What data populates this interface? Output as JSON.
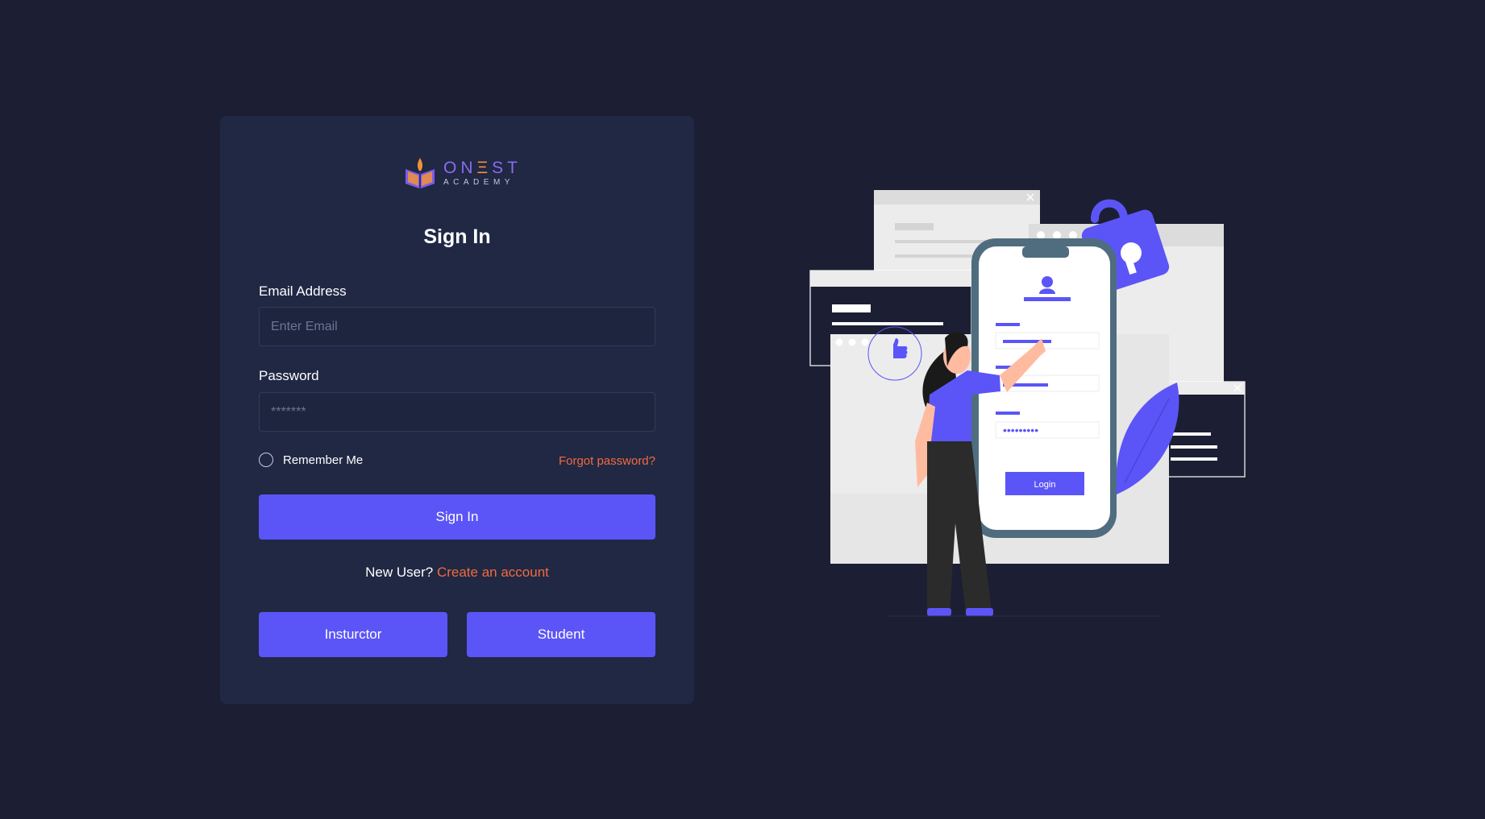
{
  "logo": {
    "main_o": "ON",
    "main_e": "Ξ",
    "main_rest": "ST",
    "sub": "ACADEMY"
  },
  "form": {
    "title": "Sign In",
    "email_label": "Email Address",
    "email_placeholder": "Enter Email",
    "password_label": "Password",
    "password_placeholder": "*******",
    "remember_label": "Remember Me",
    "forgot_label": "Forgot password?",
    "submit_label": "Sign In",
    "new_user_text": "New User?",
    "create_account_label": "Create an account",
    "instructor_label": "Insturctor",
    "student_label": "Student"
  },
  "illustration": {
    "login_button_label": "Login"
  },
  "colors": {
    "background": "#1c1f33",
    "card": "#202844",
    "accent": "#5b55f7",
    "link": "#f26a3f"
  }
}
